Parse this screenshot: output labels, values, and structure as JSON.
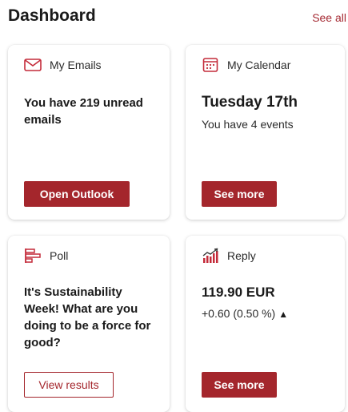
{
  "header": {
    "title": "Dashboard",
    "see_all": "See all"
  },
  "cards": {
    "emails": {
      "label": "My Emails",
      "text": "You have 219 unread emails",
      "button": "Open Outlook",
      "icon": "envelope-icon"
    },
    "calendar": {
      "label": "My Calendar",
      "date": "Tuesday 17th",
      "events": "You have 4 events",
      "button": "See more",
      "icon": "calendar-icon"
    },
    "poll": {
      "label": "Poll",
      "question": "It's Sustainability Week! What are you doing to be a force for good?",
      "button": "View results",
      "icon": "poll-icon"
    },
    "stock": {
      "label": "Reply",
      "price": "119.90 EUR",
      "change": "+0.60 (0.50 %)",
      "button": "See more",
      "icon": "stock-chart-icon"
    }
  },
  "colors": {
    "accent": "#a4262c",
    "link": "#a52a33"
  }
}
